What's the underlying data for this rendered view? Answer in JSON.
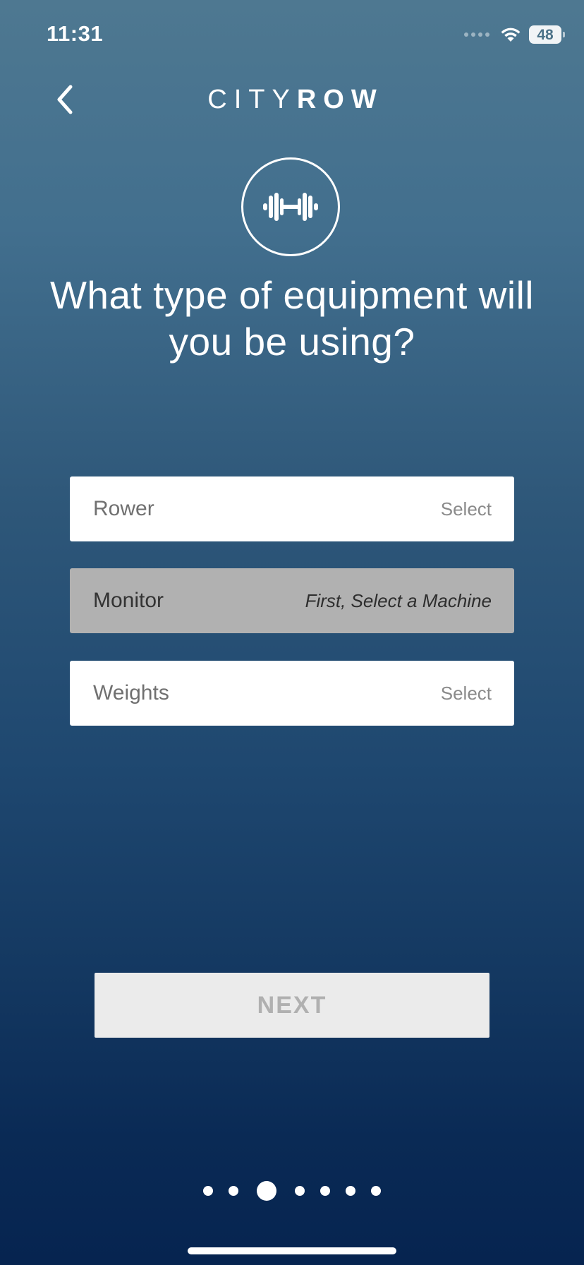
{
  "status_bar": {
    "time": "11:31",
    "battery": "48",
    "wifi_icon": "wifi-icon",
    "signal_icon": "signal-dots-icon"
  },
  "header": {
    "back_icon": "chevron-left-icon",
    "logo_light": "CITY",
    "logo_bold": "ROW"
  },
  "hero": {
    "icon": "dumbbell-icon",
    "title_line1": "What type of equipment will",
    "title_line2": "you be using?"
  },
  "options": [
    {
      "label": "Rower",
      "action": "Select",
      "enabled": true
    },
    {
      "label": "Monitor",
      "action": "First, Select a Machine",
      "enabled": false
    },
    {
      "label": "Weights",
      "action": "Select",
      "enabled": true
    }
  ],
  "next_button": {
    "label": "NEXT",
    "enabled": false
  },
  "pager": {
    "total": 7,
    "active_index": 2
  },
  "colors": {
    "gradient_top": "#4e7891",
    "gradient_bottom": "#062450",
    "row_bg": "#ffffff",
    "row_disabled_bg": "#b1b1b1",
    "next_bg": "#ebebeb",
    "next_text": "#b0b0b0"
  }
}
